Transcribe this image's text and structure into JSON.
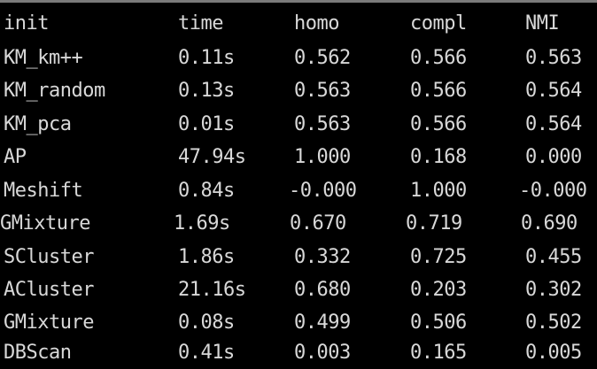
{
  "table": {
    "headers": [
      "init",
      "time",
      "homo",
      "compl",
      "NMI"
    ],
    "rows": [
      {
        "init": "KM_km++",
        "time": "0.11s",
        "homo": "0.562",
        "compl": "0.566",
        "nmi": "0.563"
      },
      {
        "init": "KM_random",
        "time": "0.13s",
        "homo": "0.563",
        "compl": "0.566",
        "nmi": "0.564"
      },
      {
        "init": "KM_pca",
        "time": "0.01s",
        "homo": "0.563",
        "compl": "0.566",
        "nmi": "0.564"
      },
      {
        "init": "AP",
        "time": "47.94s",
        "homo": "1.000",
        "compl": "0.168",
        "nmi": "0.000"
      },
      {
        "init": "Meshift",
        "time": "0.84s",
        "homo": "-0.000",
        "compl": "1.000",
        "nmi": "-0.000"
      },
      {
        "init": "GMixture",
        "time": "1.69s",
        "homo": "0.670",
        "compl": "0.719",
        "nmi": "0.690"
      },
      {
        "init": "SCluster",
        "time": "1.86s",
        "homo": "0.332",
        "compl": "0.725",
        "nmi": "0.455"
      },
      {
        "init": "ACluster",
        "time": "21.16s",
        "homo": "0.680",
        "compl": "0.203",
        "nmi": "0.302"
      },
      {
        "init": "GMixture",
        "time": "0.08s",
        "homo": "0.499",
        "compl": "0.506",
        "nmi": "0.502"
      },
      {
        "init": "DBScan",
        "time": "0.41s",
        "homo": "0.003",
        "compl": "0.165",
        "nmi": "0.005"
      }
    ]
  },
  "colors": {
    "background": "#000000",
    "text": "#d8d8d8",
    "rule": "#7a7a7a"
  }
}
